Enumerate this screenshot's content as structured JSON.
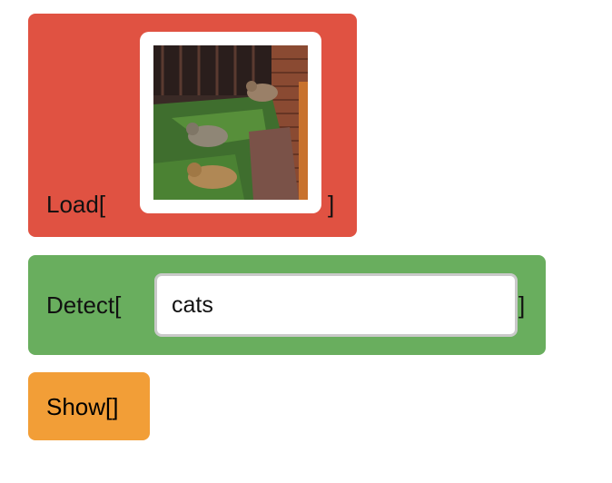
{
  "colors": {
    "load_bg": "#e05242",
    "detect_bg": "#69ae5e",
    "show_bg": "#f29e37"
  },
  "load": {
    "prefix": "Load[",
    "suffix": "]",
    "image_icon": "cats-photo"
  },
  "detect": {
    "prefix": "Detect[",
    "suffix": "]",
    "value": "cats"
  },
  "show": {
    "label": "Show[]"
  }
}
